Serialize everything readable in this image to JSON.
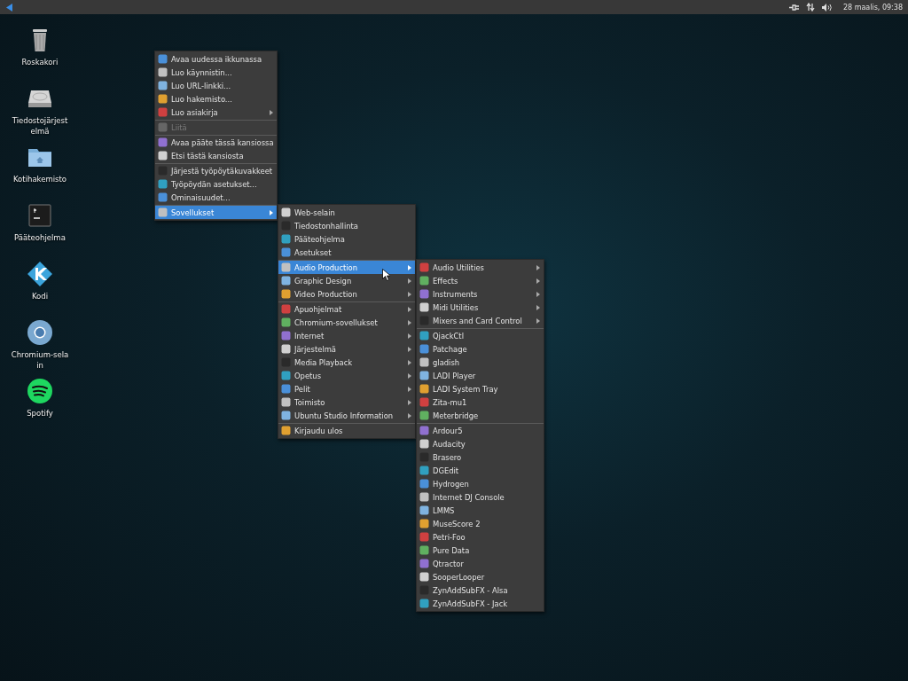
{
  "top_panel": {
    "clock": "28 maalis, 09:38"
  },
  "desktop_icons": [
    {
      "kind": "trash",
      "label": "Roskakori"
    },
    {
      "kind": "drive",
      "label": "Tiedostojärjestelmä"
    },
    {
      "kind": "folder",
      "label": "Kotihakemisto"
    },
    {
      "kind": "terminal",
      "label": "Pääteohjelma"
    },
    {
      "kind": "kodi",
      "label": "Kodi"
    },
    {
      "kind": "browser",
      "label": "Chromium-selain"
    },
    {
      "kind": "music",
      "label": "Spotify"
    }
  ],
  "menus": [
    {
      "items": [
        {
          "label": "Avaa uudessa ikkunassa",
          "selected": false,
          "disabled": false,
          "submenu": false,
          "separator_before": false
        },
        {
          "label": "Luo käynnistin...",
          "selected": false,
          "disabled": false,
          "submenu": false,
          "separator_before": false
        },
        {
          "label": "Luo URL-linkki...",
          "selected": false,
          "disabled": false,
          "submenu": false,
          "separator_before": false
        },
        {
          "label": "Luo hakemisto...",
          "selected": false,
          "disabled": false,
          "submenu": false,
          "separator_before": false
        },
        {
          "label": "Luo asiakirja",
          "selected": false,
          "disabled": false,
          "submenu": true,
          "separator_before": false
        },
        {
          "label": "Liitä",
          "selected": false,
          "disabled": true,
          "submenu": false,
          "separator_before": true
        },
        {
          "label": "Avaa pääte tässä kansiossa",
          "selected": false,
          "disabled": false,
          "submenu": false,
          "separator_before": true
        },
        {
          "label": "Etsi tästä kansiosta",
          "selected": false,
          "disabled": false,
          "submenu": false,
          "separator_before": false
        },
        {
          "label": "Järjestä työpöytäkuvakkeet",
          "selected": false,
          "disabled": false,
          "submenu": false,
          "separator_before": true
        },
        {
          "label": "Työpöydän asetukset...",
          "selected": false,
          "disabled": false,
          "submenu": false,
          "separator_before": false
        },
        {
          "label": "Ominaisuudet...",
          "selected": false,
          "disabled": false,
          "submenu": false,
          "separator_before": false
        },
        {
          "label": "Sovellukset",
          "selected": true,
          "disabled": false,
          "submenu": true,
          "separator_before": true
        }
      ]
    },
    {
      "items": [
        {
          "label": "Web-selain",
          "selected": false,
          "disabled": false,
          "submenu": false,
          "separator_before": false
        },
        {
          "label": "Tiedostonhallinta",
          "selected": false,
          "disabled": false,
          "submenu": false,
          "separator_before": false
        },
        {
          "label": "Pääteohjelma",
          "selected": false,
          "disabled": false,
          "submenu": false,
          "separator_before": false
        },
        {
          "label": "Asetukset",
          "selected": false,
          "disabled": false,
          "submenu": false,
          "separator_before": false
        },
        {
          "label": "Audio Production",
          "selected": true,
          "disabled": false,
          "submenu": true,
          "separator_before": true
        },
        {
          "label": "Graphic Design",
          "selected": false,
          "disabled": false,
          "submenu": true,
          "separator_before": false
        },
        {
          "label": "Video Production",
          "selected": false,
          "disabled": false,
          "submenu": true,
          "separator_before": false
        },
        {
          "label": "Apuohjelmat",
          "selected": false,
          "disabled": false,
          "submenu": true,
          "separator_before": true
        },
        {
          "label": "Chromium-sovellukset",
          "selected": false,
          "disabled": false,
          "submenu": true,
          "separator_before": false
        },
        {
          "label": "Internet",
          "selected": false,
          "disabled": false,
          "submenu": true,
          "separator_before": false
        },
        {
          "label": "Järjestelmä",
          "selected": false,
          "disabled": false,
          "submenu": true,
          "separator_before": false
        },
        {
          "label": "Media Playback",
          "selected": false,
          "disabled": false,
          "submenu": true,
          "separator_before": false
        },
        {
          "label": "Opetus",
          "selected": false,
          "disabled": false,
          "submenu": true,
          "separator_before": false
        },
        {
          "label": "Pelit",
          "selected": false,
          "disabled": false,
          "submenu": true,
          "separator_before": false
        },
        {
          "label": "Toimisto",
          "selected": false,
          "disabled": false,
          "submenu": true,
          "separator_before": false
        },
        {
          "label": "Ubuntu Studio Information",
          "selected": false,
          "disabled": false,
          "submenu": true,
          "separator_before": false
        },
        {
          "label": "Kirjaudu ulos",
          "selected": false,
          "disabled": false,
          "submenu": false,
          "separator_before": true
        }
      ]
    },
    {
      "items": [
        {
          "label": "Audio Utilities",
          "selected": false,
          "disabled": false,
          "submenu": true,
          "separator_before": false
        },
        {
          "label": "Effects",
          "selected": false,
          "disabled": false,
          "submenu": true,
          "separator_before": false
        },
        {
          "label": "Instruments",
          "selected": false,
          "disabled": false,
          "submenu": true,
          "separator_before": false
        },
        {
          "label": "Midi Utilities",
          "selected": false,
          "disabled": false,
          "submenu": true,
          "separator_before": false
        },
        {
          "label": "Mixers and Card Control",
          "selected": false,
          "disabled": false,
          "submenu": true,
          "separator_before": false
        },
        {
          "label": "QjackCtl",
          "selected": false,
          "disabled": false,
          "submenu": false,
          "separator_before": true
        },
        {
          "label": "Patchage",
          "selected": false,
          "disabled": false,
          "submenu": false,
          "separator_before": false
        },
        {
          "label": "gladish",
          "selected": false,
          "disabled": false,
          "submenu": false,
          "separator_before": false
        },
        {
          "label": "LADI Player",
          "selected": false,
          "disabled": false,
          "submenu": false,
          "separator_before": false
        },
        {
          "label": "LADI System Tray",
          "selected": false,
          "disabled": false,
          "submenu": false,
          "separator_before": false
        },
        {
          "label": "Zita-mu1",
          "selected": false,
          "disabled": false,
          "submenu": false,
          "separator_before": false
        },
        {
          "label": "Meterbridge",
          "selected": false,
          "disabled": false,
          "submenu": false,
          "separator_before": false
        },
        {
          "label": "Ardour5",
          "selected": false,
          "disabled": false,
          "submenu": false,
          "separator_before": true
        },
        {
          "label": "Audacity",
          "selected": false,
          "disabled": false,
          "submenu": false,
          "separator_before": false
        },
        {
          "label": "Brasero",
          "selected": false,
          "disabled": false,
          "submenu": false,
          "separator_before": false
        },
        {
          "label": "DGEdit",
          "selected": false,
          "disabled": false,
          "submenu": false,
          "separator_before": false
        },
        {
          "label": "Hydrogen",
          "selected": false,
          "disabled": false,
          "submenu": false,
          "separator_before": false
        },
        {
          "label": "Internet DJ Console",
          "selected": false,
          "disabled": false,
          "submenu": false,
          "separator_before": false
        },
        {
          "label": "LMMS",
          "selected": false,
          "disabled": false,
          "submenu": false,
          "separator_before": false
        },
        {
          "label": "MuseScore 2",
          "selected": false,
          "disabled": false,
          "submenu": false,
          "separator_before": false
        },
        {
          "label": "Petri-Foo",
          "selected": false,
          "disabled": false,
          "submenu": false,
          "separator_before": false
        },
        {
          "label": "Pure Data",
          "selected": false,
          "disabled": false,
          "submenu": false,
          "separator_before": false
        },
        {
          "label": "Qtractor",
          "selected": false,
          "disabled": false,
          "submenu": false,
          "separator_before": false
        },
        {
          "label": "SooperLooper",
          "selected": false,
          "disabled": false,
          "submenu": false,
          "separator_before": false
        },
        {
          "label": "ZynAddSubFX - Alsa",
          "selected": false,
          "disabled": false,
          "submenu": false,
          "separator_before": false
        },
        {
          "label": "ZynAddSubFX - Jack",
          "selected": false,
          "disabled": false,
          "submenu": false,
          "separator_before": false
        }
      ]
    }
  ]
}
